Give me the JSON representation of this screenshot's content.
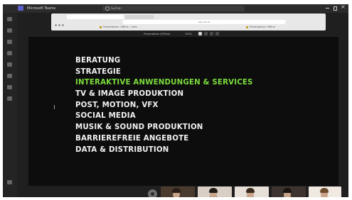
{
  "app": {
    "title": "Microsoft Teams",
    "search_placeholder": "Suchen"
  },
  "browser": {
    "url": "app.site.de",
    "bookmarks": [
      "Presentation: Offline - Latin",
      "Presentation: Offline"
    ]
  },
  "presentation": {
    "label": "Presentation (Offline)",
    "zoom": "100%"
  },
  "slide": {
    "items": [
      "BERATUNG",
      "STRATEGIE",
      "INTERAKTIVE ANWENDUNGEN & SERVICES",
      "TV & IMAGE PRODUKTION",
      "POST, MOTION, VFX",
      "SOCIAL MEDIA",
      "MUSIK & SOUND PRODUKTION",
      "BARRIEREFREIE ANGEBOTE",
      "DATA & DISTRIBUTION"
    ],
    "highlighted_index": 2,
    "text_color": "#f2f2f2",
    "highlight_color": "#7bdc3c"
  },
  "participants": {
    "count": 6
  }
}
